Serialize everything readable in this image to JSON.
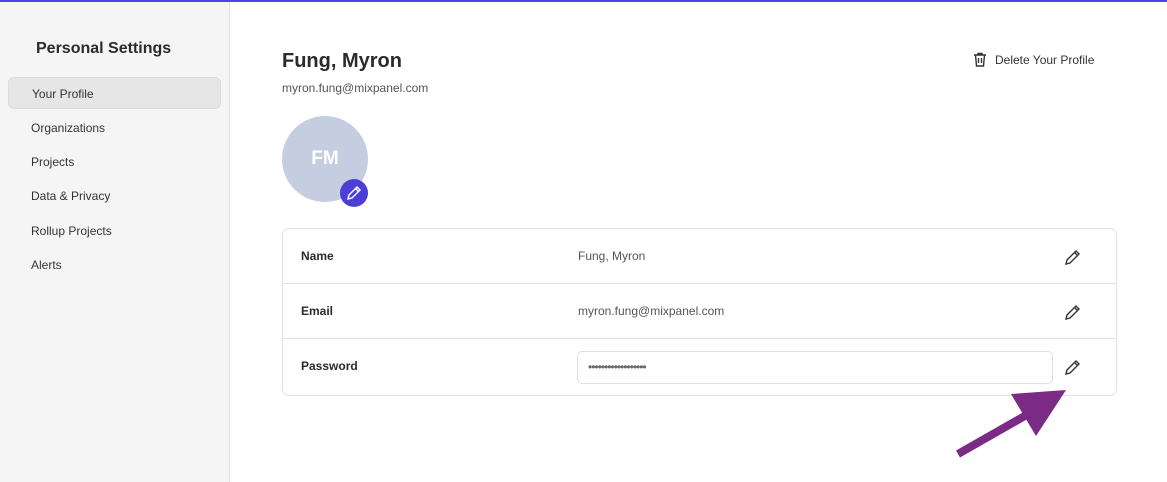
{
  "sidebar": {
    "title": "Personal Settings",
    "items": [
      {
        "label": "Your Profile",
        "active": true
      },
      {
        "label": "Organizations"
      },
      {
        "label": "Projects"
      },
      {
        "label": "Data & Privacy"
      },
      {
        "label": "Rollup Projects"
      },
      {
        "label": "Alerts"
      }
    ]
  },
  "profile": {
    "name": "Fung, Myron",
    "email": "myron.fung@mixpanel.com",
    "initials": "FM",
    "delete_label": "Delete Your Profile"
  },
  "fields": [
    {
      "label": "Name",
      "value": "Fung, Myron"
    },
    {
      "label": "Email",
      "value": "myron.fung@mixpanel.com"
    },
    {
      "label": "Password",
      "value": "••••••••••••••••••"
    }
  ],
  "colors": {
    "accent": "#4b3fd6",
    "annotation_arrow": "#7b2a86",
    "avatar": "#c5cde0"
  }
}
